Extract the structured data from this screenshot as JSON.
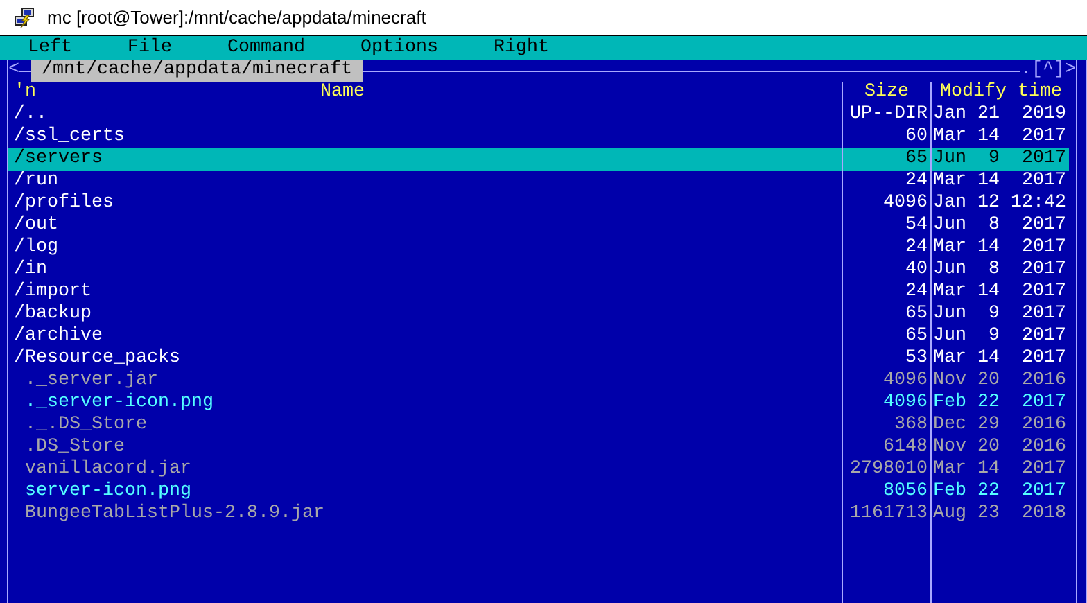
{
  "window": {
    "title": "mc [root@Tower]:/mnt/cache/appdata/minecraft"
  },
  "menu": [
    "Left",
    "File",
    "Command",
    "Options",
    "Right"
  ],
  "panel": {
    "left_marker": "<",
    "path": "/mnt/cache/appdata/minecraft",
    "right_marker": ".[^]>",
    "columns": [
      "'n",
      "Name",
      "Size",
      "Modify time"
    ],
    "rows": [
      {
        "name": "/..",
        "size": "UP--DIR",
        "modified": "Jan 21  2019",
        "kind": "dir",
        "selected": false
      },
      {
        "name": "/ssl_certs",
        "size": "60",
        "modified": "Mar 14  2017",
        "kind": "dir",
        "selected": false
      },
      {
        "name": "/servers",
        "size": "65",
        "modified": "Jun  9  2017",
        "kind": "dir",
        "selected": true
      },
      {
        "name": "/run",
        "size": "24",
        "modified": "Mar 14  2017",
        "kind": "dir",
        "selected": false
      },
      {
        "name": "/profiles",
        "size": "4096",
        "modified": "Jan 12 12:42",
        "kind": "dir",
        "selected": false
      },
      {
        "name": "/out",
        "size": "54",
        "modified": "Jun  8  2017",
        "kind": "dir",
        "selected": false
      },
      {
        "name": "/log",
        "size": "24",
        "modified": "Mar 14  2017",
        "kind": "dir",
        "selected": false
      },
      {
        "name": "/in",
        "size": "40",
        "modified": "Jun  8  2017",
        "kind": "dir",
        "selected": false
      },
      {
        "name": "/import",
        "size": "24",
        "modified": "Mar 14  2017",
        "kind": "dir",
        "selected": false
      },
      {
        "name": "/backup",
        "size": "65",
        "modified": "Jun  9  2017",
        "kind": "dir",
        "selected": false
      },
      {
        "name": "/archive",
        "size": "65",
        "modified": "Jun  9  2017",
        "kind": "dir",
        "selected": false
      },
      {
        "name": "/Resource_packs",
        "size": "53",
        "modified": "Mar 14  2017",
        "kind": "dir",
        "selected": false
      },
      {
        "name": "._server.jar",
        "size": "4096",
        "modified": "Nov 20  2016",
        "kind": "file",
        "selected": false
      },
      {
        "name": "._server-icon.png",
        "size": "4096",
        "modified": "Feb 22  2017",
        "kind": "image",
        "selected": false
      },
      {
        "name": "._.DS_Store",
        "size": "368",
        "modified": "Dec 29  2016",
        "kind": "file",
        "selected": false
      },
      {
        "name": ".DS_Store",
        "size": "6148",
        "modified": "Nov 20  2016",
        "kind": "file",
        "selected": false
      },
      {
        "name": "vanillacord.jar",
        "size": "2798010",
        "modified": "Mar 14  2017",
        "kind": "file",
        "selected": false
      },
      {
        "name": "server-icon.png",
        "size": "8056",
        "modified": "Feb 22  2017",
        "kind": "image",
        "selected": false
      },
      {
        "name": "BungeeTabListPlus-2.8.9.jar",
        "size": "1161713",
        "modified": "Aug 23  2018",
        "kind": "file",
        "selected": false
      }
    ]
  }
}
